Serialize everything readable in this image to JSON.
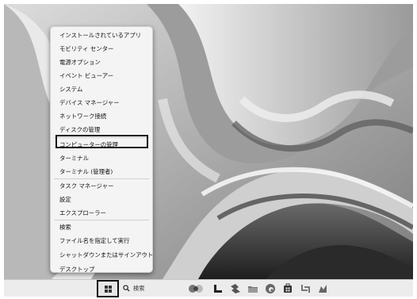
{
  "context_menu": {
    "items": [
      {
        "label": "インストールされているアプリ"
      },
      {
        "label": "モビリティ センター"
      },
      {
        "label": "電源オプション"
      },
      {
        "label": "イベント ビューアー"
      },
      {
        "label": "システム"
      },
      {
        "label": "デバイス マネージャー"
      },
      {
        "label": "ネットワーク接続"
      },
      {
        "label": "ディスクの管理"
      },
      {
        "label": "コンピューターの管理",
        "highlighted": true
      },
      {
        "label": "ターミナル"
      },
      {
        "label": "ターミナル (管理者)"
      },
      {
        "label": "タスク マネージャー"
      },
      {
        "label": "設定"
      },
      {
        "label": "エクスプローラー"
      },
      {
        "label": "検索"
      },
      {
        "label": "ファイル名を指定して実行"
      },
      {
        "label": "シャットダウンまたはサインアウト",
        "submenu_arrow": "›"
      },
      {
        "label": "デスクトップ"
      }
    ]
  },
  "taskbar": {
    "start_icon": "windows-logo-icon",
    "search_icon": "search-icon",
    "search_placeholder": "検索",
    "pinned_icons": [
      "copilot-icon",
      "task-view-icon",
      "app-icon",
      "folder-icon",
      "edge-icon",
      "store-icon",
      "snipping-tool-icon",
      "app-icon"
    ]
  },
  "colors": {
    "highlight_border": "#111111",
    "menu_background": "#f4f4f4",
    "taskbar_background": "#ececec"
  }
}
